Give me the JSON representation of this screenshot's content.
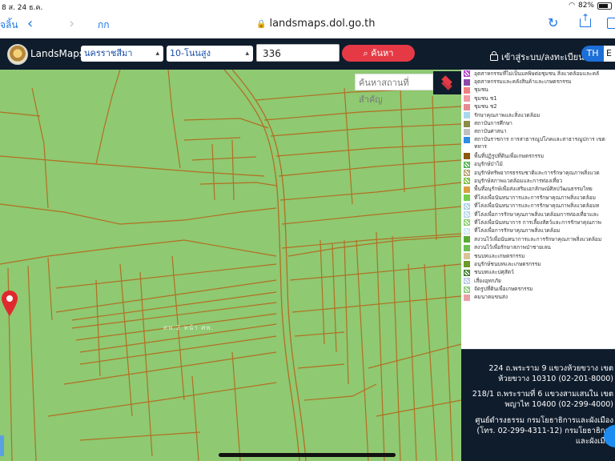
{
  "status_bar": {
    "left": "8  ส. 24 ธ.ค.",
    "battery": "82%"
  },
  "browser": {
    "back_text": "จลิ้น",
    "aa": "กก",
    "domain": "landsmaps.dol.go.th"
  },
  "app": {
    "brand": "LandsMaps",
    "province": "นครราชสีมา",
    "district": "10-โนนสูง",
    "parcel_number": "336",
    "search_label": "ค้นหา",
    "login_label": "เข้าสู่ระบบ/ลงทะเบียน",
    "lang_th": "TH",
    "lang_en": "E"
  },
  "map": {
    "place_search_placeholder": "ค้นหาสถานที่สำคัญ",
    "parcel_label": "ศพ.2 หน้า ศพ."
  },
  "legend": [
    {
      "label": "อุตสาหกรรมที่ไม่เป็นมลพิษต่อชุมชน สิ่งแวดล้อมและคลั",
      "color": "#b23ec8",
      "hatch": true
    },
    {
      "label": "อุตสาหกรรมและคลังสินค้าและเกษตรกรรม",
      "color": "#8d4aa8",
      "hatch": false
    },
    {
      "label": "ชุมชน",
      "color": "#f08080",
      "hatch": false
    },
    {
      "label": "ชุมชน ช1",
      "color": "#f19aa1",
      "hatch": false
    },
    {
      "label": "ชุมชน ช2",
      "color": "#e78b93",
      "hatch": false
    },
    {
      "label": "รักษาคุณภาพและสิ่งแวดล้อม",
      "color": "#a8d7ee",
      "hatch": false
    },
    {
      "label": "สถาบันการศึกษา",
      "color": "#8b8b4a",
      "hatch": false
    },
    {
      "label": "สถาบันศาสนา",
      "color": "#c0c0c0",
      "hatch": false
    },
    {
      "label": "สถาบันราชการ การสาธารณูปโภคและสาธารณูปการ เขตทหาร",
      "color": "#2f8de4",
      "hatch": false,
      "tall": true
    },
    {
      "label": "พื้นที่ปฏิรูปที่ดินเพื่อเกษตรกรรม",
      "color": "#8a5a10",
      "hatch": false
    },
    {
      "label": "อนุรักษ์ป่าไม้",
      "color": "#4cb24c",
      "hatch": true
    },
    {
      "label": "อนุรักษ์ทรัพยากรธรรมชาติและการรักษาคุณภาพสิ่งแวด",
      "color": "#b8a070",
      "hatch": true
    },
    {
      "label": "อนุรักษ์สภาพแวดล้อมและการท่องเที่ยว",
      "color": "#7bbf3f",
      "hatch": true
    },
    {
      "label": "พื้นที่อนุรักษ์เพื่อส่งเสริมเอกลักษณ์ศิลปวัฒนธรรมไทย",
      "color": "#d9a040",
      "hatch": false
    },
    {
      "label": "ที่โล่งเพื่อนันทนาการและการรักษาคุณภาพสิ่งแวดล้อม",
      "color": "#72d04a",
      "hatch": false
    },
    {
      "label": "ที่โล่งเพื่อนันทนาการและการรักษาคุณภาพสิ่งแวดล้อมท",
      "color": "#a8d0e8",
      "hatch": true
    },
    {
      "label": "ที่โล่งเพื่อการรักษาคุณภาพสิ่งแวดล้อมการท่องเที่ยวและ",
      "color": "#b9d7ee",
      "hatch": true
    },
    {
      "label": "ที่โล่งเพื่อนันทนาการ การเลี้ยงสัตว์และการรักษาคุณภาพ",
      "color": "#8ad06a",
      "hatch": true
    },
    {
      "label": "ที่โล่งเพื่อการรักษาคุณภาพสิ่งแวดล้อม",
      "color": "#c8e6f4",
      "hatch": true
    },
    {
      "label": "สงวนไว้เพื่อนันทนาการและการรักษาคุณภาพสิ่งแวดล้อม",
      "color": "#5aa832",
      "hatch": false
    },
    {
      "label": "สงวนไว้เพื่อรักษาสภาพป่าชายเลน",
      "color": "#6cbf55",
      "hatch": false
    },
    {
      "label": "ชนบทและเกษตรกรรม",
      "color": "#d8c39a",
      "hatch": false
    },
    {
      "label": "อนุรักษ์ชนบทและเกษตรกรรม",
      "color": "#6a9a2a",
      "hatch": false
    },
    {
      "label": "ชนบทและปศุสัตว์",
      "color": "#3f7a2a",
      "hatch": true
    },
    {
      "label": "เสี่ยงอุทกภัย",
      "color": "#b8c8e8",
      "hatch": true
    },
    {
      "label": "จัดรูปที่ดินเพื่อเกษตรกรรม",
      "color": "#8ac878",
      "hatch": true
    },
    {
      "label": "คมนาคมขนส่ง",
      "color": "#e8a0a8",
      "hatch": false
    }
  ],
  "info_panel": {
    "address_1": "224 ถ.พระราม 9 แขวงห้วยขวาง เขตห้วยขวาง 10310 (02-201-8000)",
    "address_2": "218/1 ถ.พระรามที่ 6 แขวงสามเสนใน เขตพญาไท 10400 (02-299-4000)",
    "address_3": "ศูนย์ดำรงธรรม กรมโยธาธิการและผังเมือง (โทร. 02-299-4311-12) กรมโยธาธิการและผังเมือง"
  }
}
